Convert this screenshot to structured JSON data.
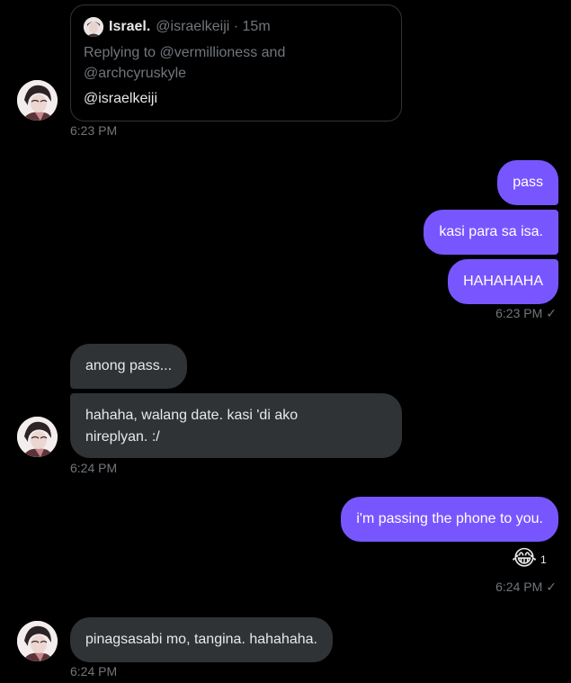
{
  "quoted_tweet": {
    "name": "Israel.",
    "handle_time": "@israelkeiji · 15m",
    "replying": "Replying to @vermillioness and @archcyruskyle",
    "body": "@israelkeiji"
  },
  "messages": [
    {
      "from": "them",
      "text": "",
      "time": "6:23 PM"
    },
    {
      "from": "me",
      "text": "pass"
    },
    {
      "from": "me",
      "text": "kasi para sa isa."
    },
    {
      "from": "me",
      "text": "HAHAHAHA",
      "time": "6:23 PM"
    },
    {
      "from": "them",
      "text": "anong pass..."
    },
    {
      "from": "them",
      "text": "hahaha, walang date. kasi 'di ako nireplyan. :/",
      "text_line1": "hahaha, walang date. kasi 'di ako",
      "text_line2": "nireplyan. :/",
      "time": "6:24 PM"
    },
    {
      "from": "me",
      "text": "i'm passing the phone to you.",
      "reaction": "😂",
      "reaction_count": "1",
      "time": "6:24 PM"
    },
    {
      "from": "them",
      "text": "pinagsasabi mo, tangina. hahahaha.",
      "time": "6:24 PM"
    }
  ],
  "times": {
    "t1": "6:23 PM",
    "t2": "6:23 PM",
    "t3": "6:24 PM",
    "t4": "6:24 PM",
    "t5": "6:24 PM"
  },
  "read_check": "✓"
}
